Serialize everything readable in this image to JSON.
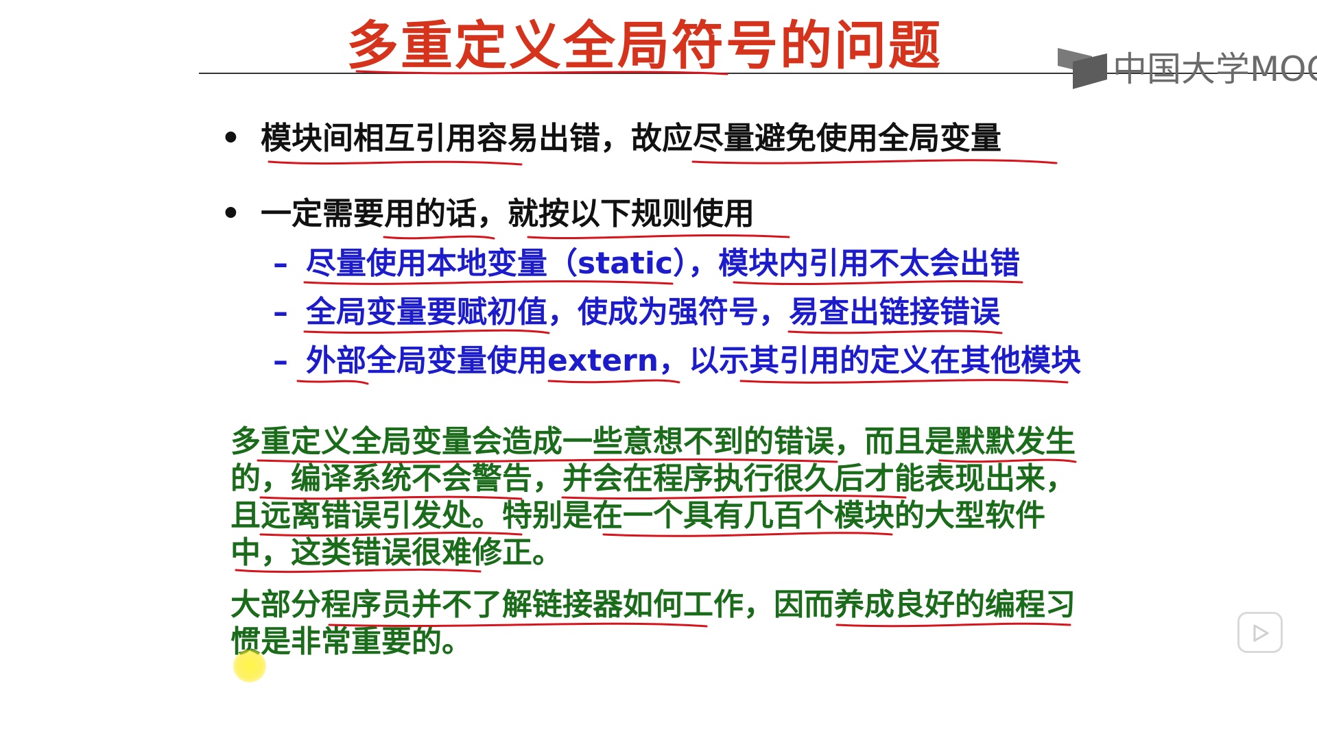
{
  "title": "多重定义全局符号的问题",
  "logo": {
    "text": "中国大学MOOC",
    "icon": "mooc-logo-icon"
  },
  "bullets": [
    {
      "marker": "•",
      "text": "模块间相互引用容易出错，故应尽量避免使用全局变量"
    },
    {
      "marker": "•",
      "text": "一定需要用的话，就按以下规则使用"
    }
  ],
  "sub_bullets": [
    {
      "marker": "–",
      "text": "尽量使用本地变量（static），模块内引用不太会出错"
    },
    {
      "marker": "–",
      "text": "全局变量要赋初值，使成为强符号，易查出链接错误"
    },
    {
      "marker": "–",
      "text": "外部全局变量使用extern，以示其引用的定义在其他模块"
    }
  ],
  "paragraphs": [
    "多重定义全局变量会造成一些意想不到的错误，而且是默默发生的，编译系统不会警告，并会在程序执行很久后才能表现出来，且远离错误引发处。特别是在一个具有几百个模块的大型软件中，这类错误很难修正。",
    "大部分程序员并不了解链接器如何工作，因而养成良好的编程习惯是非常重要的。"
  ],
  "player": {
    "play_icon": "play-icon"
  },
  "colors": {
    "title": "#d5331c",
    "bullet_text": "#111111",
    "sub_bullet_text": "#1c1ccc",
    "paragraph_text": "#1a6b1a",
    "annotation_ink": "#d6141c"
  }
}
